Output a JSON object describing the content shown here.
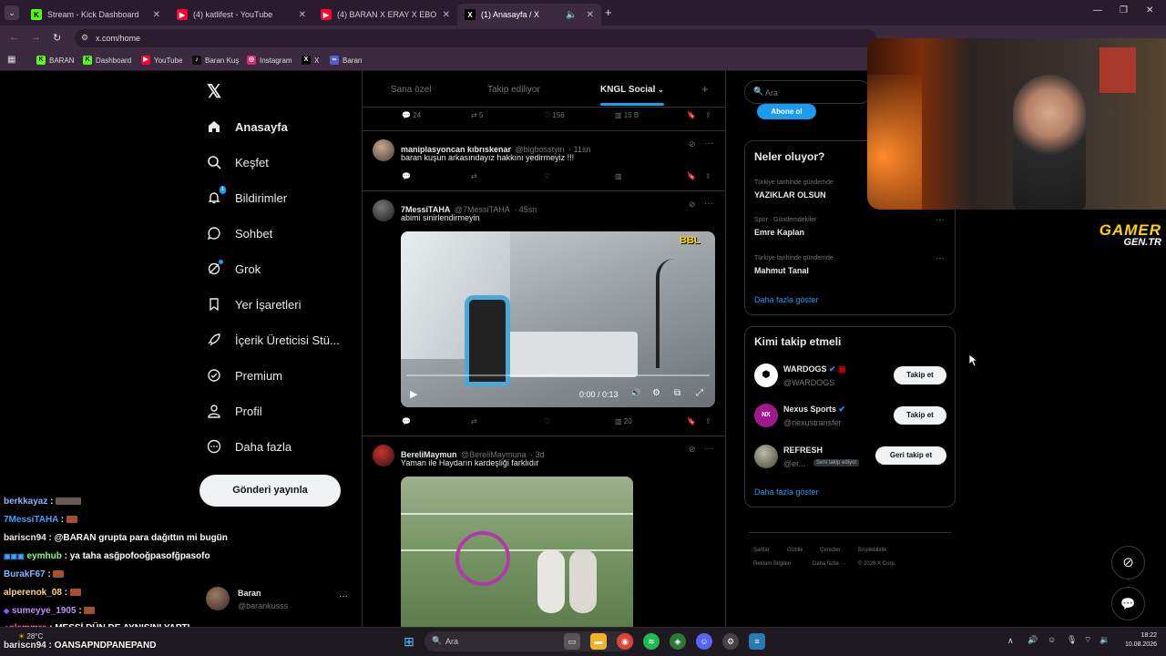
{
  "browser": {
    "tabs": [
      {
        "title": "Stream - Kick Dashboard",
        "icon": "K"
      },
      {
        "title": "(4) katlifest - YouTube",
        "icon": "youtube-icon"
      },
      {
        "title": "(4) BARAN X ERAY X EBONIVON",
        "icon": "youtube-icon"
      },
      {
        "title": "(1) Anasayfa / X",
        "icon": "X"
      }
    ],
    "url": "x.com/home",
    "bookmarks": [
      "BARAN",
      "Dashboard",
      "YouTube",
      "Baran Kuş",
      "Instagram",
      "X",
      "Baran"
    ]
  },
  "x_nav": {
    "items": [
      "Anasayfa",
      "Keşfet",
      "Bildirimler",
      "Sohbet",
      "Grok",
      "Yer İşaretleri",
      "İçerik Üreticisi Stü...",
      "Premium",
      "Profil",
      "Daha fazla"
    ],
    "notif_badge": "1",
    "post_button": "Gönderi yayınla",
    "account": {
      "name": "Baran",
      "handle": "@barankusss"
    }
  },
  "feed": {
    "tabs": [
      "Sana özel",
      "Takip ediliyor",
      "KNGL Social"
    ],
    "top_actions": {
      "replies": "24",
      "reposts": "5",
      "likes": "156",
      "views": "15 B"
    },
    "tweets": [
      {
        "name": "maniplasyoncan kıbrıskenar",
        "handle": "@bigbosstyin",
        "time": "· 11sn",
        "text": "baran kuşun arkasındayız hakkını yedirmeyiz !!!",
        "views": ""
      },
      {
        "name": "7MessiTAHA",
        "handle": "@7MessiTAHA",
        "time": "· 45sn",
        "text": "abimi sinirlendirmeyin",
        "video_time": "0:00 / 0:13",
        "video_badge": "BBL",
        "views": "20"
      },
      {
        "name": "BereliMaymun",
        "handle": "@BereliMaymuna",
        "time": "· 3d",
        "text": "Yaman ile Haydarın kardeşliği farklıdır"
      }
    ]
  },
  "right": {
    "search_placeholder": "Ara",
    "subscribe": "Abone ol",
    "trends_title": "Neler oluyor?",
    "trends": [
      {
        "meta": "Türkiye tarihinde gündemde",
        "name": "YAZIKLAR OLSUN"
      },
      {
        "meta": "Spor · Gündemdekiler",
        "name": "Emre Kaplan"
      },
      {
        "meta": "Türkiye tarihinde gündemde",
        "name": "Mahmut Tanal"
      }
    ],
    "show_more": "Daha fazla göster",
    "who_title": "Kimi takip etmeli",
    "who": [
      {
        "name": "WARDOGS",
        "handle": "@WARDOGS",
        "button": "Takip et"
      },
      {
        "name": "Nexus Sports",
        "handle": "@nexustransfer",
        "button": "Takip et"
      },
      {
        "name": "REFRESH",
        "handle": "@er...",
        "badge": "Seni takip ediyor",
        "button": "Geri takip et"
      }
    ],
    "footer": [
      "Şartlar",
      "Gizlilik",
      "Çerezler",
      "Erişilebilirlik",
      "Reklam Bilgileri",
      "Daha fazla ···",
      "© 2026 X Corp."
    ]
  },
  "overlay": {
    "logo_line1": "GAMER",
    "logo_line2": "GEN.TR"
  },
  "chat": [
    {
      "user": "berkkayaz",
      "color": "#8fb3ff",
      "msg": ""
    },
    {
      "user": "7MessiTAHA",
      "color": "#3fa2ff",
      "msg": ""
    },
    {
      "user": "bariscn94",
      "color": "#e7e7e7",
      "msg": "@BARAN grupta para dağıttın mi bugün"
    },
    {
      "user": "eymhub",
      "color": "#7cff7c",
      "msg": "ya taha asğpofooğpasofğpasofo"
    },
    {
      "user": "BurakF67",
      "color": "#8fb3ff",
      "msg": ""
    },
    {
      "user": "alperenok_08",
      "color": "#ffd37c",
      "msg": ""
    },
    {
      "user": "sumeyye_1905",
      "color": "#c08cff",
      "msg": ""
    },
    {
      "user": "alemmre",
      "color": "#ff5fa2",
      "msg": "MESSİ DÜN DE AYNISINI YAPTI"
    },
    {
      "user": "bariscn94",
      "color": "#e7e7e7",
      "msg": "OANSAPNDPANEPAND"
    }
  ],
  "taskbar": {
    "search": "Ara",
    "weather": "28°C",
    "time": "18:22",
    "date": "10.08.2026"
  }
}
